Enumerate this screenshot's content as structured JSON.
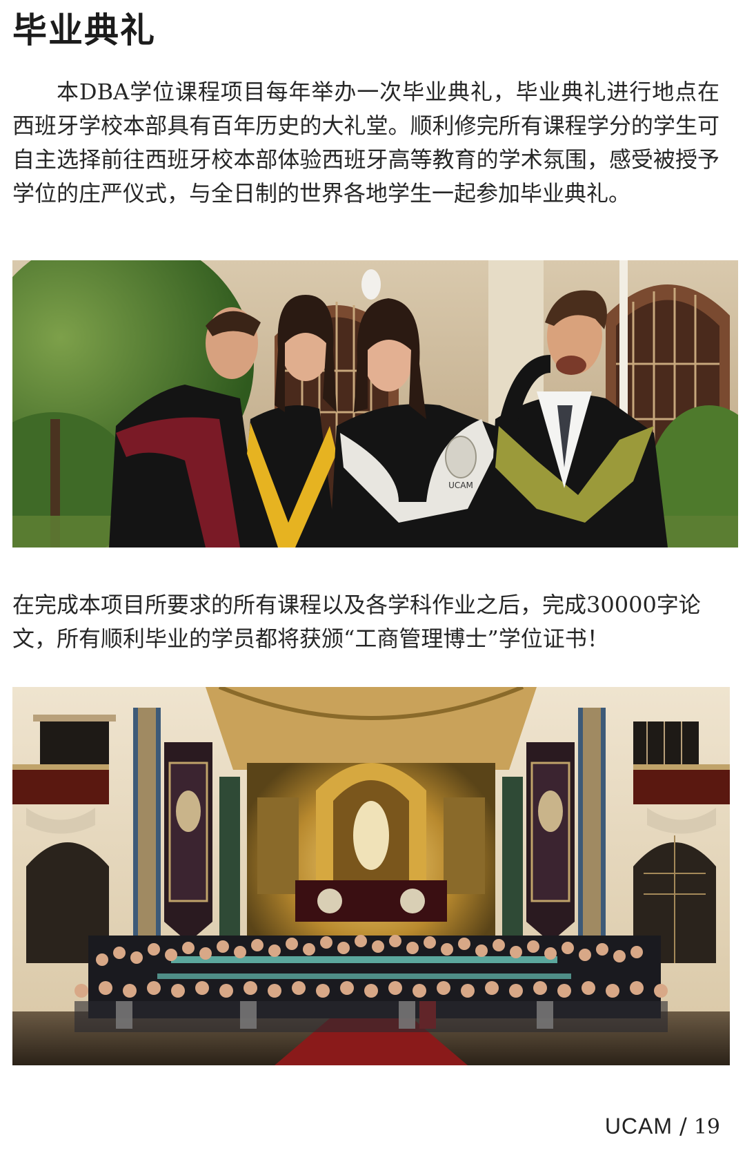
{
  "page": {
    "title": "毕业典礼",
    "intro_paragraph": "本DBA学位课程项目每年举办一次毕业典礼，毕业典礼进行地点在西班牙学校本部具有百年历史的大礼堂。顺利修完所有课程学分的学生可自主选择前往西班牙校本部体验西班牙高等教育的学术氛围，感受被授予学位的庄严仪式，与全日制的世界各地学生一起参加毕业典礼。",
    "thesis_paragraph": "在完成本项目所要求的所有课程以及各学科作业之后，完成30000字论文，所有顺利毕业的学员都将获颁“工商管理博士”学位证书！",
    "photo_top": {
      "stole_label": "UCAM",
      "colors": {
        "gown": "#141414",
        "stole_burgundy": "#7a1a26",
        "stole_yellow": "#e6b321",
        "stole_white": "#e8e6e0",
        "stole_olive": "#9b9a3a"
      }
    }
  },
  "footer": {
    "brand": "UCAM",
    "separator": "/",
    "page_number": "19"
  }
}
